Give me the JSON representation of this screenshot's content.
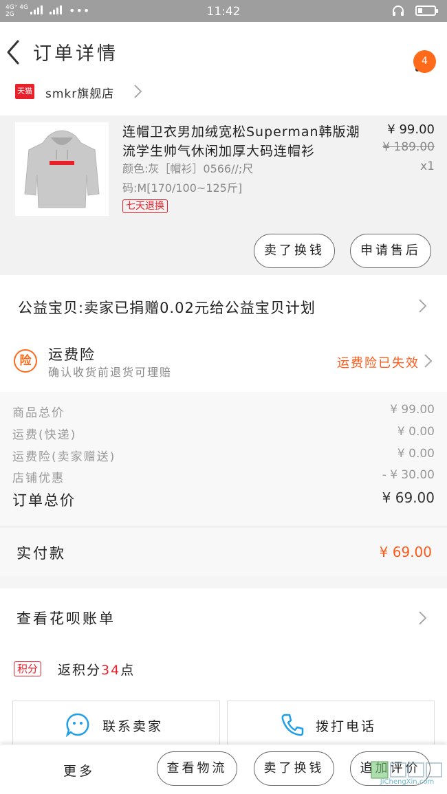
{
  "status_bar": {
    "network_top": "4G⁺ 4G",
    "network_bottom": "2G",
    "network2": "2G",
    "more": "•••",
    "time": "11:42"
  },
  "header": {
    "title": "订单详情",
    "badge_count": "4"
  },
  "shop": {
    "platform_logo": "天猫",
    "name": "smkr旗舰店"
  },
  "product": {
    "title": "连帽卫衣男加绒宽松Superman韩版潮流学生帅气休闲加厚大码连帽衫",
    "sku": "颜色:灰［帽衫］0566//;尺码:M[170/100~125斤]",
    "tag": "七天退换",
    "price": "¥ 99.00",
    "original_price": "¥ 189.00",
    "quantity": "x1",
    "actions": [
      "卖了换钱",
      "申请售后"
    ]
  },
  "charity": {
    "text": "公益宝贝:卖家已捐赠0.02元给公益宝贝计划"
  },
  "insurance": {
    "icon_char": "险",
    "title": "运费险",
    "subtitle": "确认收货前退货可理赔",
    "status": "运费险已失效",
    "accent_color": "#ff5a1a"
  },
  "summary": {
    "rows": [
      {
        "label": "商品总价",
        "value": "¥ 99.00"
      },
      {
        "label": "运费(快递)",
        "value": "¥ 0.00"
      },
      {
        "label": "运费险(卖家赠送)",
        "value": "¥ 0.00"
      },
      {
        "label": "店铺优惠",
        "value": "- ¥ 30.00"
      }
    ],
    "total_label": "订单总价",
    "total_value": "¥ 69.00"
  },
  "payment": {
    "label": "实付款",
    "value": "¥ 69.00"
  },
  "huabei": {
    "text": "查看花呗账单"
  },
  "points": {
    "tag": "积分",
    "prefix": "返积分",
    "number": "34",
    "suffix": "点"
  },
  "contact": {
    "seller": "联系卖家",
    "phone": "拨打电话"
  },
  "bottom_bar": {
    "more": "更多",
    "buttons": [
      "查看物流",
      "卖了换钱",
      "追加评价"
    ]
  },
  "watermark": {
    "text": "JiChengXin.com"
  },
  "colors": {
    "brand_red": "#e8202a",
    "orange": "#ff6a1a"
  }
}
